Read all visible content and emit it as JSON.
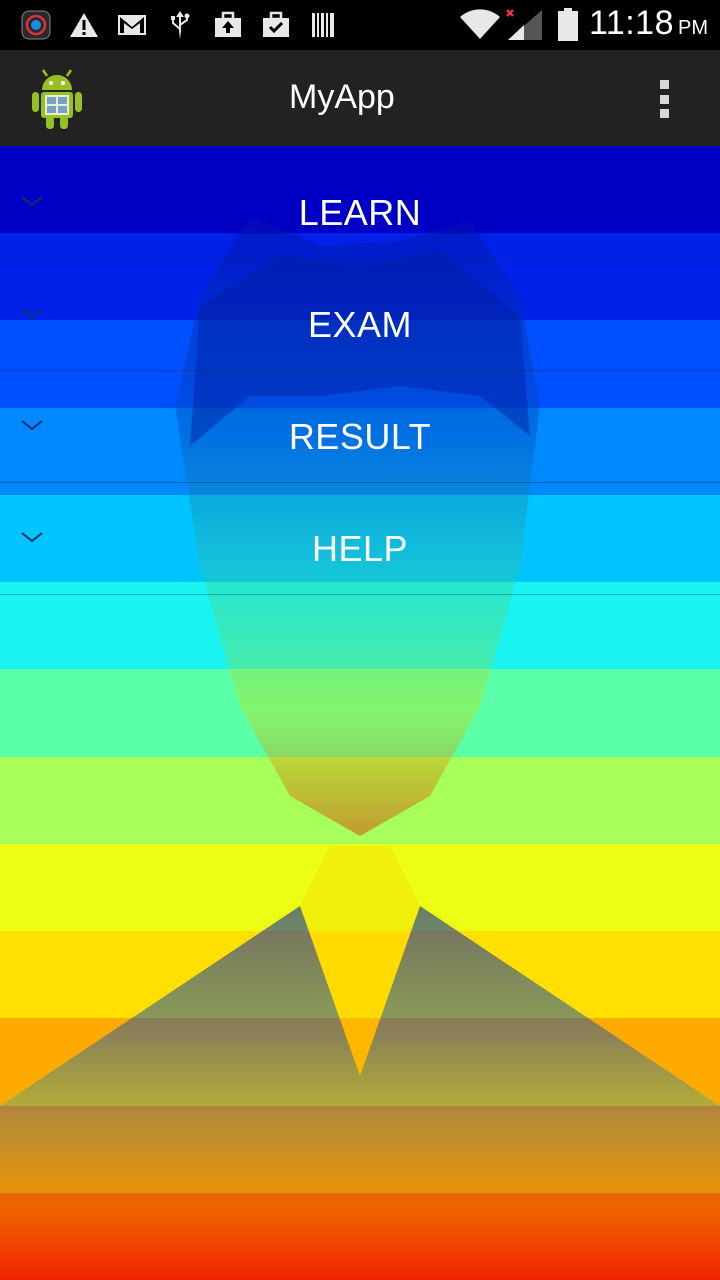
{
  "status_bar": {
    "time": "11:18",
    "ampm": "PM",
    "icons": [
      "app-notification-icon",
      "warning-icon",
      "gmail-icon",
      "usb-icon",
      "briefcase-upload-icon",
      "briefcase-check-icon",
      "barcode-icon",
      "wifi-icon",
      "signal-no-service-icon",
      "battery-icon"
    ]
  },
  "action_bar": {
    "title": "MyApp",
    "app_icon": "android-calculator-icon",
    "overflow_icon": "overflow-menu-icon"
  },
  "menu": {
    "items": [
      {
        "label": "LEARN"
      },
      {
        "label": "EXAM"
      },
      {
        "label": "RESULT"
      },
      {
        "label": "HELP"
      }
    ],
    "expand_icon": "chevron-down-icon"
  },
  "colors": {
    "gradient": [
      "#0000c4",
      "#0022e8",
      "#0050ff",
      "#0088ff",
      "#00c4ff",
      "#19f4f0",
      "#5bffa8",
      "#a8ff5a",
      "#eaff14",
      "#ffe000",
      "#ffaa00",
      "#ff6a00",
      "#ff2200"
    ],
    "action_bar_bg": "#222222"
  }
}
